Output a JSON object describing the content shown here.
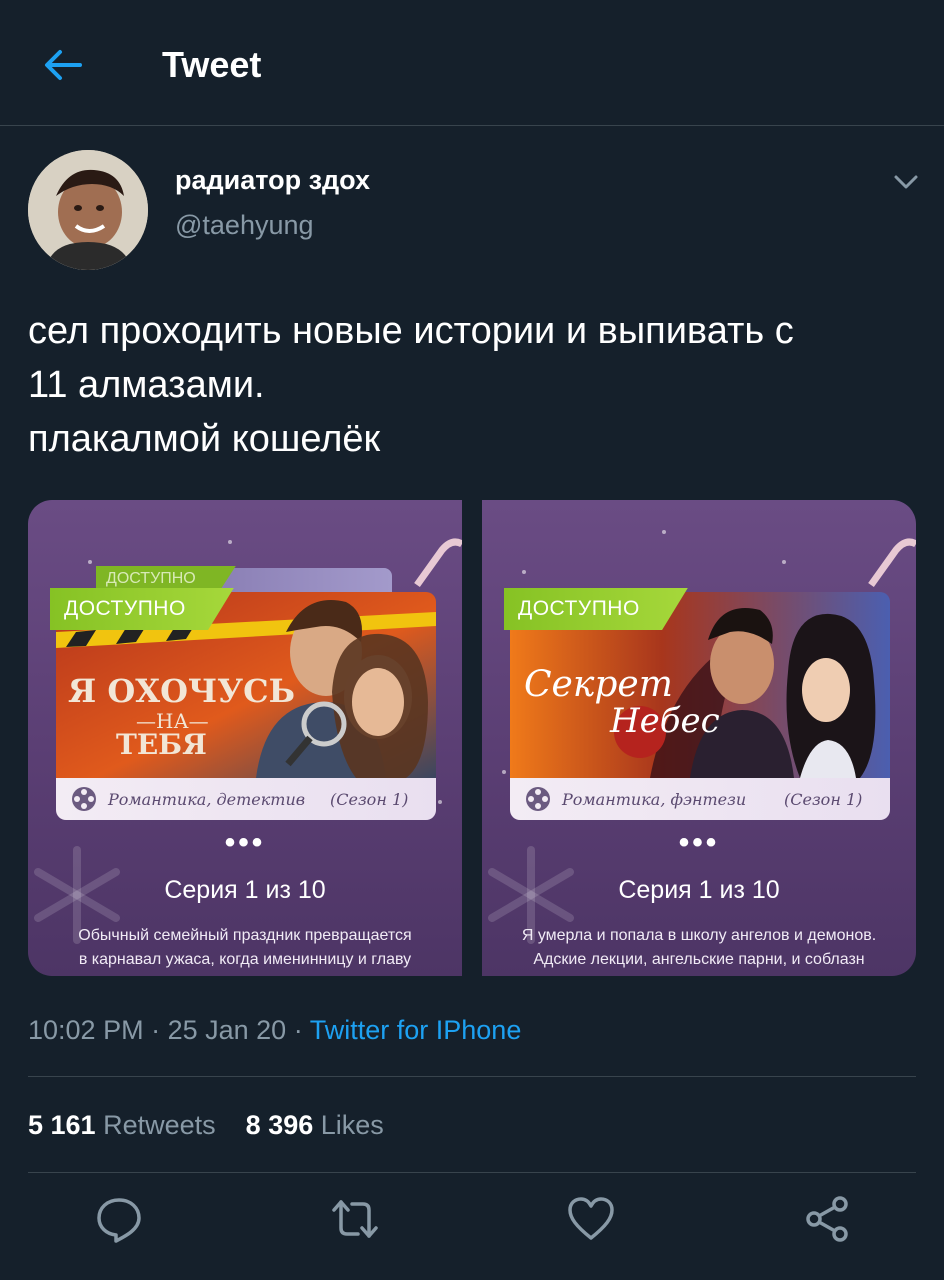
{
  "header": {
    "title": "Tweet"
  },
  "author": {
    "name": "радиатор здох",
    "handle": "@taehyung"
  },
  "tweet": {
    "lines": [
      "сел проходить новые истории и выпивать с",
      "11 алмазами.",
      "плакалмой кошелёк"
    ]
  },
  "media": [
    {
      "tag": "ДОСТУПНО",
      "tag_back": "ДОСТУПНО",
      "title": "Я ОХОЧУСЬ НА ТЕБЯ",
      "genre": "Романтика, детектив",
      "season": "(Сезон 1)",
      "series": "Серия 1 из 10",
      "description": [
        "Обычный семейный праздник превращается",
        "в карнавал ужаса, когда именинницу и главу"
      ]
    },
    {
      "tag": "ДОСТУПНО",
      "title": "Секрет Небес",
      "genre": "Романтика, фэнтези",
      "season": "(Сезон 1)",
      "series": "Серия 1 из 10",
      "description": [
        "Я умерла и попала в школу ангелов и демонов.",
        "Адские лекции, ангельские парни, и соблазн"
      ]
    }
  ],
  "meta": {
    "time": "10:02 PM",
    "date": "25 Jan 20",
    "source": "Twitter for IPhone"
  },
  "stats": {
    "retweets": "5 161",
    "retweets_label": "Retweets",
    "likes": "8 396",
    "likes_label": "Likes"
  },
  "colors": {
    "background": "#15202b",
    "accent": "#1da1f2",
    "muted": "#8899a6",
    "divider": "#38444d",
    "tag_green": "#8cc63f"
  },
  "icons": [
    "back-arrow-icon",
    "chevron-down-icon",
    "reply-icon",
    "retweet-icon",
    "like-icon",
    "share-icon"
  ]
}
